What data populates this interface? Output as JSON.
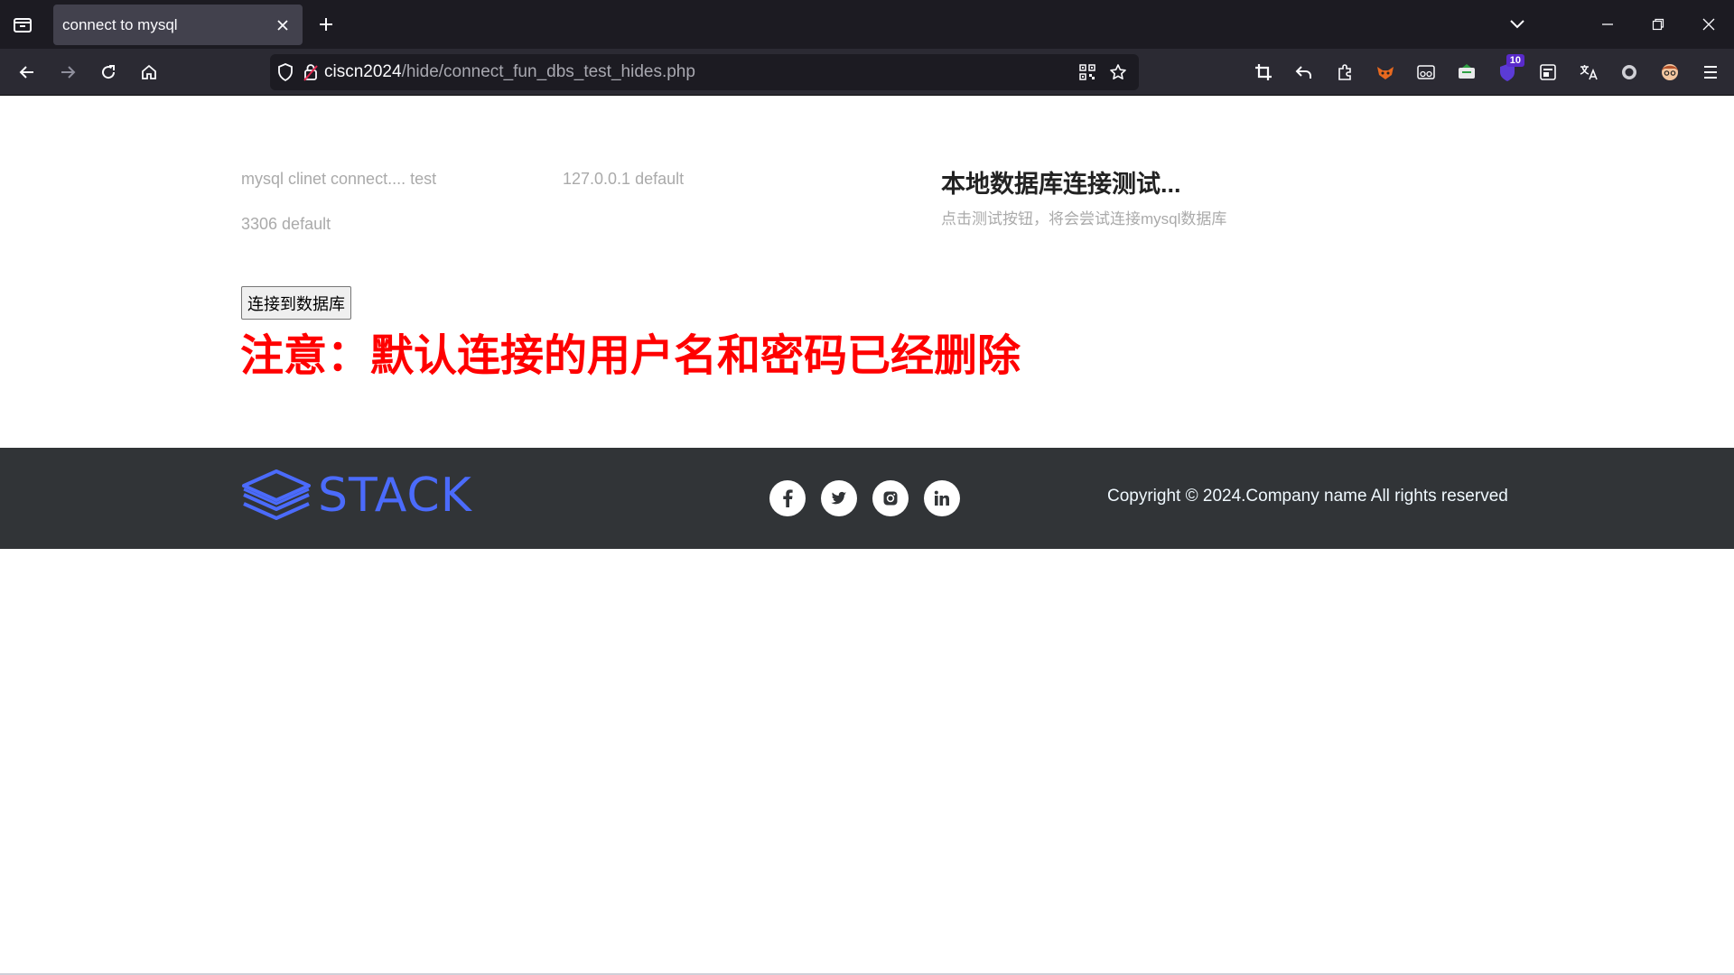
{
  "browser": {
    "tab_title": "connect to mysql",
    "url_host": "ciscn2024",
    "url_path": "/hide/connect_fun_dbs_test_hides.php",
    "extension_badge": "10"
  },
  "page": {
    "client_label": "mysql clinet connect.... test",
    "host_label": "127.0.0.1 default",
    "port_label": "3306 default",
    "side_title": "本地数据库连接测试...",
    "side_desc": "点击测试按钮，将会尝试连接mysql数据库",
    "connect_button": "连接到数据库",
    "warning": "注意：默认连接的用户名和密码已经删除"
  },
  "footer": {
    "logo_text": "STACK",
    "social": [
      "facebook-icon",
      "twitter-icon",
      "instagram-icon",
      "linkedin-icon"
    ],
    "copyright": "Copyright © 2024.Company name All rights reserved"
  },
  "colors": {
    "warning": "#ff0000",
    "footer_bg": "#313437",
    "logo": "#4b6bfb"
  }
}
